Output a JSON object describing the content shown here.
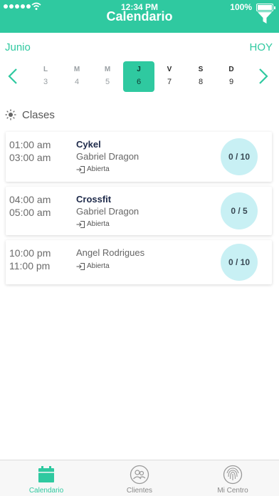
{
  "status_bar": {
    "time": "12:34 PM",
    "battery": "100%"
  },
  "header": {
    "title": "Calendario"
  },
  "calendar": {
    "month": "Junio",
    "today_label": "HOY",
    "days": [
      {
        "letter": "L",
        "number": "3"
      },
      {
        "letter": "M",
        "number": "4"
      },
      {
        "letter": "M",
        "number": "5"
      },
      {
        "letter": "J",
        "number": "6"
      },
      {
        "letter": "V",
        "number": "7"
      },
      {
        "letter": "S",
        "number": "8"
      },
      {
        "letter": "D",
        "number": "9"
      }
    ]
  },
  "section": {
    "title": "Clases"
  },
  "classes": [
    {
      "start": "01:00 am",
      "end": "03:00 am",
      "name": "Cykel",
      "trainer": "Gabriel Dragon",
      "status": "Abierta",
      "capacity": "0 / 10"
    },
    {
      "start": "04:00 am",
      "end": "05:00 am",
      "name": "Crossfit",
      "trainer": "Gabriel Dragon",
      "status": "Abierta",
      "capacity": "0 / 5"
    },
    {
      "start": "10:00 pm",
      "end": "11:00 pm",
      "name": "",
      "trainer": "Angel Rodrigues",
      "status": "Abierta",
      "capacity": "0 / 10"
    }
  ],
  "tabs": [
    {
      "label": "Calendario"
    },
    {
      "label": "Clientes"
    },
    {
      "label": "Mi Centro"
    }
  ],
  "colors": {
    "accent": "#2fc9a0",
    "capacity_bg": "#c8f0f4"
  }
}
